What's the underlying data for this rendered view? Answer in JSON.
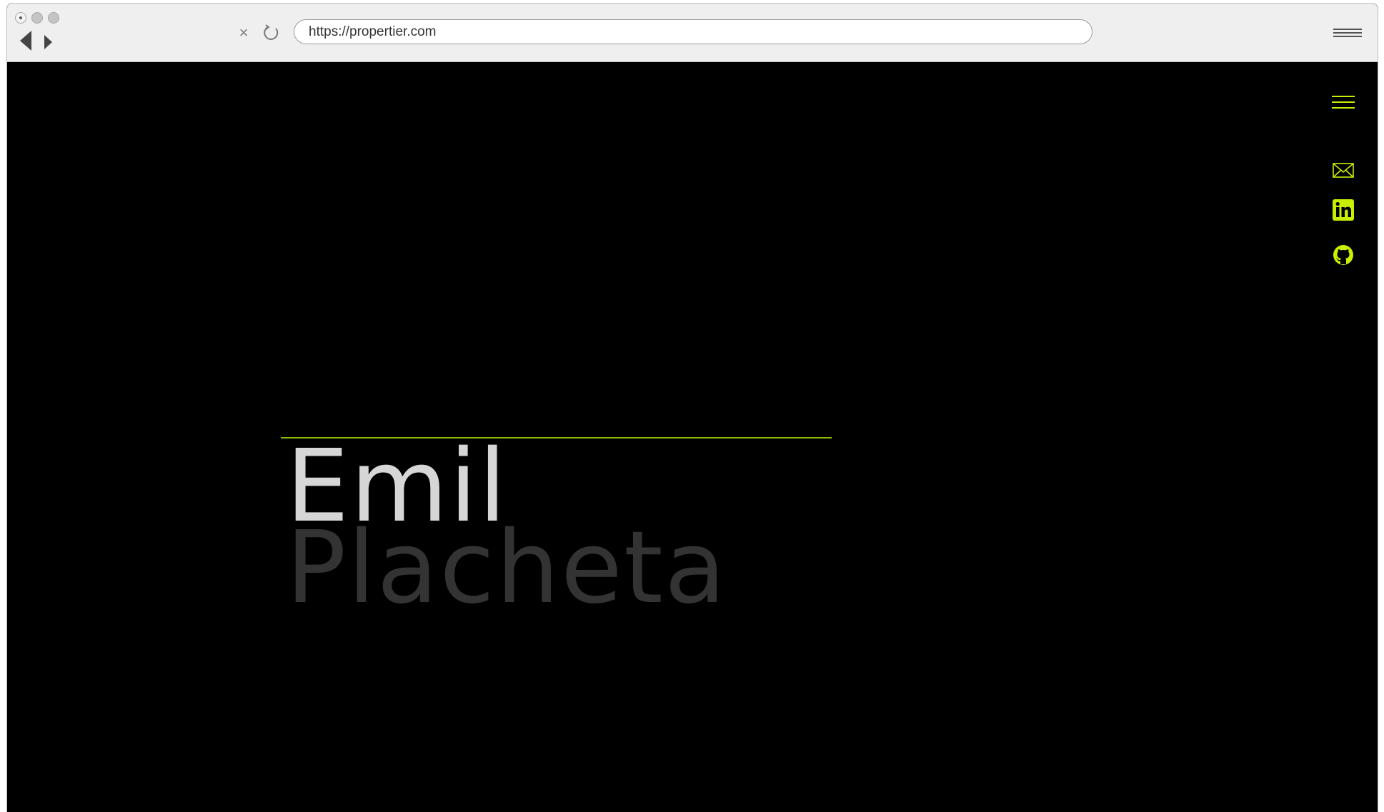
{
  "browser": {
    "url": "https://propertier.com",
    "stop_icon": "close-icon",
    "reload_icon": "reload-icon",
    "menu_icon": "hamburger-icon"
  },
  "site": {
    "accent_color": "#c8ef00",
    "background_color": "#000000",
    "menu_icon": "hamburger-icon",
    "social": [
      {
        "name": "email",
        "icon": "envelope-icon"
      },
      {
        "name": "linkedin",
        "icon": "linkedin-icon"
      },
      {
        "name": "github",
        "icon": "github-icon"
      }
    ],
    "hero": {
      "first_name": "Emil",
      "last_name": "Placheta",
      "first_name_color": "#d6d6d6",
      "last_name_color": "#333333"
    }
  }
}
